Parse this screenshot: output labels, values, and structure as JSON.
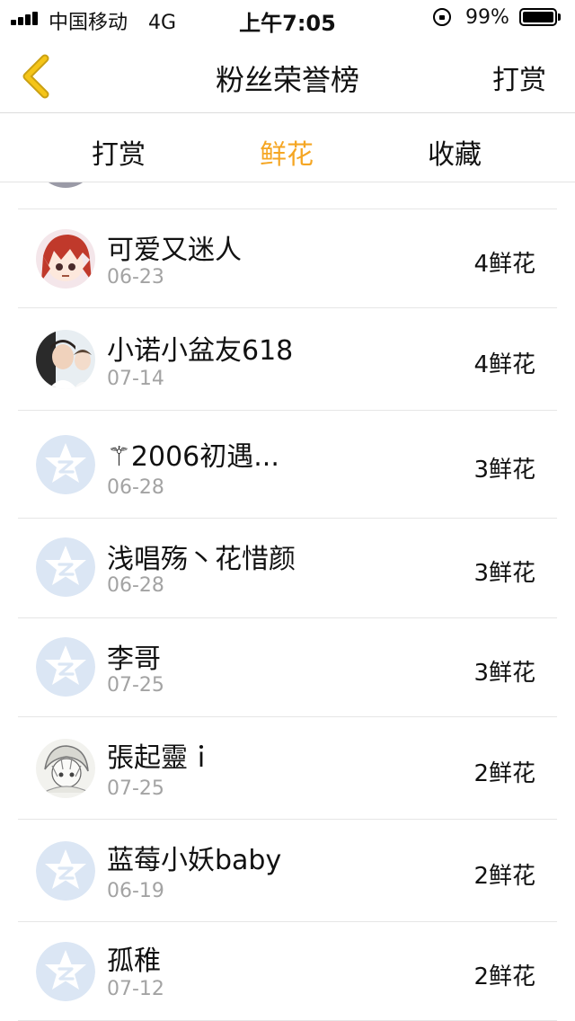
{
  "status_bar": {
    "carrier": "中国移动",
    "network": "4G",
    "time": "上午7:05",
    "battery": "99%",
    "battery_level": 0.99
  },
  "nav": {
    "back_icon": "chevron-left-icon",
    "title": "粉丝荣誉榜",
    "action_label": "打赏"
  },
  "tabs": [
    {
      "label": "打赏",
      "active": false
    },
    {
      "label": "鲜花",
      "active": true
    },
    {
      "label": "收藏",
      "active": false
    }
  ],
  "colors": {
    "accent": "#f5a623",
    "back_icon": "#f5c518",
    "date_text": "#a3a3a3",
    "default_avatar": "#dbe6f4"
  },
  "fans": [
    {
      "name": "可爱又迷人",
      "date": "06-23",
      "flowers": "4鲜花",
      "avatar": "anime-girl-avatar"
    },
    {
      "name": "小诺小盆友618",
      "date": "07-14",
      "flowers": "4鲜花",
      "avatar": "photo-avatar"
    },
    {
      "name": "⚚2006初遇...",
      "date": "06-28",
      "flowers": "3鲜花",
      "avatar": "default-qq-avatar"
    },
    {
      "name": "浅唱殇丶花惜颜",
      "date": "06-28",
      "flowers": "3鲜花",
      "avatar": "default-qq-avatar"
    },
    {
      "name": "李哥",
      "date": "07-25",
      "flowers": "3鲜花",
      "avatar": "default-qq-avatar"
    },
    {
      "name": "張起靈ｉ",
      "date": "07-25",
      "flowers": "2鲜花",
      "avatar": "sketch-avatar"
    },
    {
      "name": "蓝莓小妖baby",
      "date": "06-19",
      "flowers": "2鲜花",
      "avatar": "default-qq-avatar"
    },
    {
      "name": "孤稚",
      "date": "07-12",
      "flowers": "2鲜花",
      "avatar": "default-qq-avatar"
    }
  ]
}
